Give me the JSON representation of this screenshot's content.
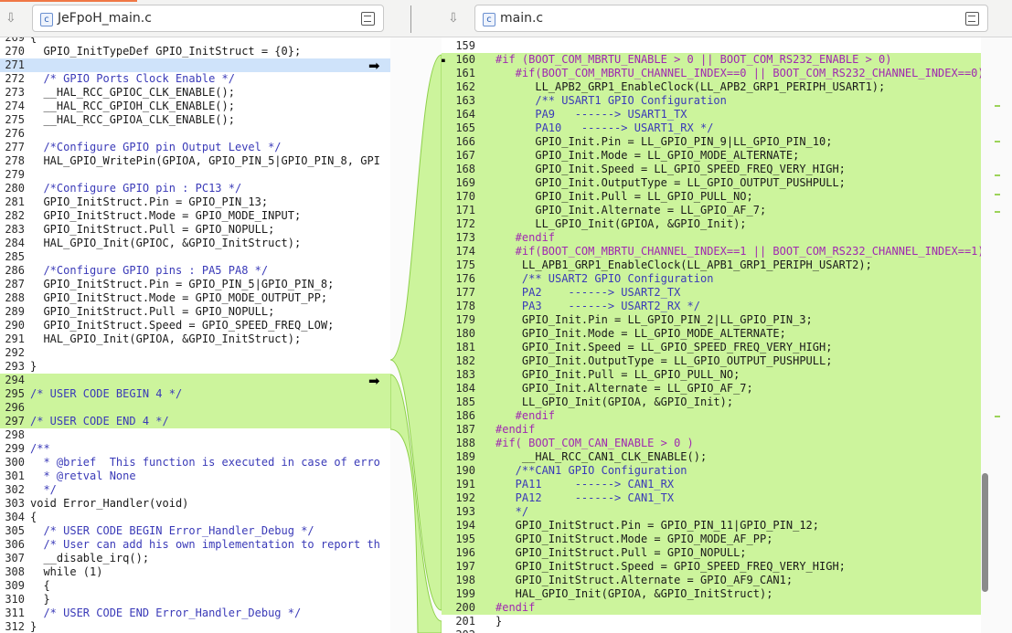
{
  "colors": {
    "added": "#ccf49c",
    "current": "#cfe3fa",
    "comment": "#3a3ab8",
    "preprocessor": "#a029b0",
    "accent": "#f07746"
  },
  "left": {
    "filename": "JeFpoH_main.c",
    "file_icon": "c-file-icon",
    "download_icon": "download-icon",
    "doc_icon": "document-icon",
    "lines": [
      {
        "n": "269",
        "t": "{"
      },
      {
        "n": "270",
        "t": "  GPIO_InitTypeDef GPIO_InitStruct = {0};"
      },
      {
        "n": "271",
        "t": "",
        "state": "current"
      },
      {
        "n": "272",
        "t": "  /* GPIO Ports Clock Enable */"
      },
      {
        "n": "273",
        "t": "  __HAL_RCC_GPIOC_CLK_ENABLE();"
      },
      {
        "n": "274",
        "t": "  __HAL_RCC_GPIOH_CLK_ENABLE();"
      },
      {
        "n": "275",
        "t": "  __HAL_RCC_GPIOA_CLK_ENABLE();"
      },
      {
        "n": "276",
        "t": ""
      },
      {
        "n": "277",
        "t": "  /*Configure GPIO pin Output Level */"
      },
      {
        "n": "278",
        "t": "  HAL_GPIO_WritePin(GPIOA, GPIO_PIN_5|GPIO_PIN_8, GPI"
      },
      {
        "n": "279",
        "t": ""
      },
      {
        "n": "280",
        "t": "  /*Configure GPIO pin : PC13 */"
      },
      {
        "n": "281",
        "t": "  GPIO_InitStruct.Pin = GPIO_PIN_13;"
      },
      {
        "n": "282",
        "t": "  GPIO_InitStruct.Mode = GPIO_MODE_INPUT;"
      },
      {
        "n": "283",
        "t": "  GPIO_InitStruct.Pull = GPIO_NOPULL;"
      },
      {
        "n": "284",
        "t": "  HAL_GPIO_Init(GPIOC, &GPIO_InitStruct);"
      },
      {
        "n": "285",
        "t": ""
      },
      {
        "n": "286",
        "t": "  /*Configure GPIO pins : PA5 PA8 */"
      },
      {
        "n": "287",
        "t": "  GPIO_InitStruct.Pin = GPIO_PIN_5|GPIO_PIN_8;"
      },
      {
        "n": "288",
        "t": "  GPIO_InitStruct.Mode = GPIO_MODE_OUTPUT_PP;"
      },
      {
        "n": "289",
        "t": "  GPIO_InitStruct.Pull = GPIO_NOPULL;"
      },
      {
        "n": "290",
        "t": "  GPIO_InitStruct.Speed = GPIO_SPEED_FREQ_LOW;"
      },
      {
        "n": "291",
        "t": "  HAL_GPIO_Init(GPIOA, &GPIO_InitStruct);"
      },
      {
        "n": "292",
        "t": ""
      },
      {
        "n": "293",
        "t": "}"
      },
      {
        "n": "294",
        "t": "",
        "state": "added"
      },
      {
        "n": "295",
        "t": "/* USER CODE BEGIN 4 */",
        "state": "added"
      },
      {
        "n": "296",
        "t": "",
        "state": "added"
      },
      {
        "n": "297",
        "t": "/* USER CODE END 4 */",
        "state": "added"
      },
      {
        "n": "298",
        "t": ""
      },
      {
        "n": "299",
        "t": "/**"
      },
      {
        "n": "300",
        "t": "  * @brief  This function is executed in case of erro"
      },
      {
        "n": "301",
        "t": "  * @retval None"
      },
      {
        "n": "302",
        "t": "  */"
      },
      {
        "n": "303",
        "t": "void Error_Handler(void)"
      },
      {
        "n": "304",
        "t": "{"
      },
      {
        "n": "305",
        "t": "  /* USER CODE BEGIN Error_Handler_Debug */"
      },
      {
        "n": "306",
        "t": "  /* User can add his own implementation to report th"
      },
      {
        "n": "307",
        "t": "  __disable_irq();"
      },
      {
        "n": "308",
        "t": "  while (1)"
      },
      {
        "n": "309",
        "t": "  {"
      },
      {
        "n": "310",
        "t": "  }"
      },
      {
        "n": "311",
        "t": "  /* USER CODE END Error_Handler_Debug */"
      },
      {
        "n": "312",
        "t": "}"
      }
    ]
  },
  "right": {
    "filename": "main.c",
    "file_icon": "c-file-icon",
    "download_icon": "download-icon",
    "doc_icon": "document-icon",
    "lines": [
      {
        "n": "159",
        "t": ""
      },
      {
        "n": "160",
        "t": "#if (BOOT_COM_MBRTU_ENABLE > 0 || BOOT_COM_RS232_ENABLE > 0)",
        "state": "added",
        "k": "pp"
      },
      {
        "n": "161",
        "t": "   #if(BOOT_COM_MBRTU_CHANNEL_INDEX==0 || BOOT_COM_RS232_CHANNEL_INDEX==0)",
        "state": "added",
        "k": "pp"
      },
      {
        "n": "162",
        "t": "      LL_APB2_GRP1_EnableClock(LL_APB2_GRP1_PERIPH_USART1);",
        "state": "added"
      },
      {
        "n": "163",
        "t": "      /** USART1 GPIO Configuration",
        "state": "added",
        "k": "cm"
      },
      {
        "n": "164",
        "t": "      PA9   ------> USART1_TX",
        "state": "added",
        "k": "cm"
      },
      {
        "n": "165",
        "t": "      PA10   ------> USART1_RX */",
        "state": "added",
        "k": "cm"
      },
      {
        "n": "166",
        "t": "      GPIO_Init.Pin = LL_GPIO_PIN_9|LL_GPIO_PIN_10;",
        "state": "added"
      },
      {
        "n": "167",
        "t": "      GPIO_Init.Mode = LL_GPIO_MODE_ALTERNATE;",
        "state": "added"
      },
      {
        "n": "168",
        "t": "      GPIO_Init.Speed = LL_GPIO_SPEED_FREQ_VERY_HIGH;",
        "state": "added"
      },
      {
        "n": "169",
        "t": "      GPIO_Init.OutputType = LL_GPIO_OUTPUT_PUSHPULL;",
        "state": "added"
      },
      {
        "n": "170",
        "t": "      GPIO_Init.Pull = LL_GPIO_PULL_NO;",
        "state": "added"
      },
      {
        "n": "171",
        "t": "      GPIO_Init.Alternate = LL_GPIO_AF_7;",
        "state": "added"
      },
      {
        "n": "172",
        "t": "      LL_GPIO_Init(GPIOA, &GPIO_Init);",
        "state": "added"
      },
      {
        "n": "173",
        "t": "   #endif",
        "state": "added",
        "k": "pp"
      },
      {
        "n": "174",
        "t": "   #if(BOOT_COM_MBRTU_CHANNEL_INDEX==1 || BOOT_COM_RS232_CHANNEL_INDEX==1)",
        "state": "added",
        "k": "pp"
      },
      {
        "n": "175",
        "t": "    LL_APB1_GRP1_EnableClock(LL_APB1_GRP1_PERIPH_USART2);",
        "state": "added"
      },
      {
        "n": "176",
        "t": "    /** USART2 GPIO Configuration",
        "state": "added",
        "k": "cm"
      },
      {
        "n": "177",
        "t": "    PA2    ------> USART2_TX",
        "state": "added",
        "k": "cm"
      },
      {
        "n": "178",
        "t": "    PA3    ------> USART2_RX */",
        "state": "added",
        "k": "cm"
      },
      {
        "n": "179",
        "t": "    GPIO_Init.Pin = LL_GPIO_PIN_2|LL_GPIO_PIN_3;",
        "state": "added"
      },
      {
        "n": "180",
        "t": "    GPIO_Init.Mode = LL_GPIO_MODE_ALTERNATE;",
        "state": "added"
      },
      {
        "n": "181",
        "t": "    GPIO_Init.Speed = LL_GPIO_SPEED_FREQ_VERY_HIGH;",
        "state": "added"
      },
      {
        "n": "182",
        "t": "    GPIO_Init.OutputType = LL_GPIO_OUTPUT_PUSHPULL;",
        "state": "added"
      },
      {
        "n": "183",
        "t": "    GPIO_Init.Pull = LL_GPIO_PULL_NO;",
        "state": "added"
      },
      {
        "n": "184",
        "t": "    GPIO_Init.Alternate = LL_GPIO_AF_7;",
        "state": "added"
      },
      {
        "n": "185",
        "t": "    LL_GPIO_Init(GPIOA, &GPIO_Init);",
        "state": "added"
      },
      {
        "n": "186",
        "t": "   #endif",
        "state": "added",
        "k": "pp"
      },
      {
        "n": "187",
        "t": "#endif",
        "state": "added",
        "k": "pp"
      },
      {
        "n": "188",
        "t": "#if( BOOT_COM_CAN_ENABLE > 0 )",
        "state": "added",
        "k": "pp"
      },
      {
        "n": "189",
        "t": "    __HAL_RCC_CAN1_CLK_ENABLE();",
        "state": "added"
      },
      {
        "n": "190",
        "t": "   /**CAN1 GPIO Configuration",
        "state": "added",
        "k": "cm"
      },
      {
        "n": "191",
        "t": "   PA11     ------> CAN1_RX",
        "state": "added",
        "k": "cm"
      },
      {
        "n": "192",
        "t": "   PA12     ------> CAN1_TX",
        "state": "added",
        "k": "cm"
      },
      {
        "n": "193",
        "t": "   */",
        "state": "added",
        "k": "cm"
      },
      {
        "n": "194",
        "t": "   GPIO_InitStruct.Pin = GPIO_PIN_11|GPIO_PIN_12;",
        "state": "added"
      },
      {
        "n": "195",
        "t": "   GPIO_InitStruct.Mode = GPIO_MODE_AF_PP;",
        "state": "added"
      },
      {
        "n": "196",
        "t": "   GPIO_InitStruct.Pull = GPIO_NOPULL;",
        "state": "added"
      },
      {
        "n": "197",
        "t": "   GPIO_InitStruct.Speed = GPIO_SPEED_FREQ_VERY_HIGH;",
        "state": "added"
      },
      {
        "n": "198",
        "t": "   GPIO_InitStruct.Alternate = GPIO_AF9_CAN1;",
        "state": "added"
      },
      {
        "n": "199",
        "t": "   HAL_GPIO_Init(GPIOA, &GPIO_InitStruct);",
        "state": "added"
      },
      {
        "n": "200",
        "t": "#endif",
        "state": "added",
        "k": "pp"
      },
      {
        "n": "201",
        "t": "}"
      },
      {
        "n": "202",
        "t": ""
      }
    ]
  },
  "arrows": {
    "right": "➡",
    "left": "⬅"
  }
}
